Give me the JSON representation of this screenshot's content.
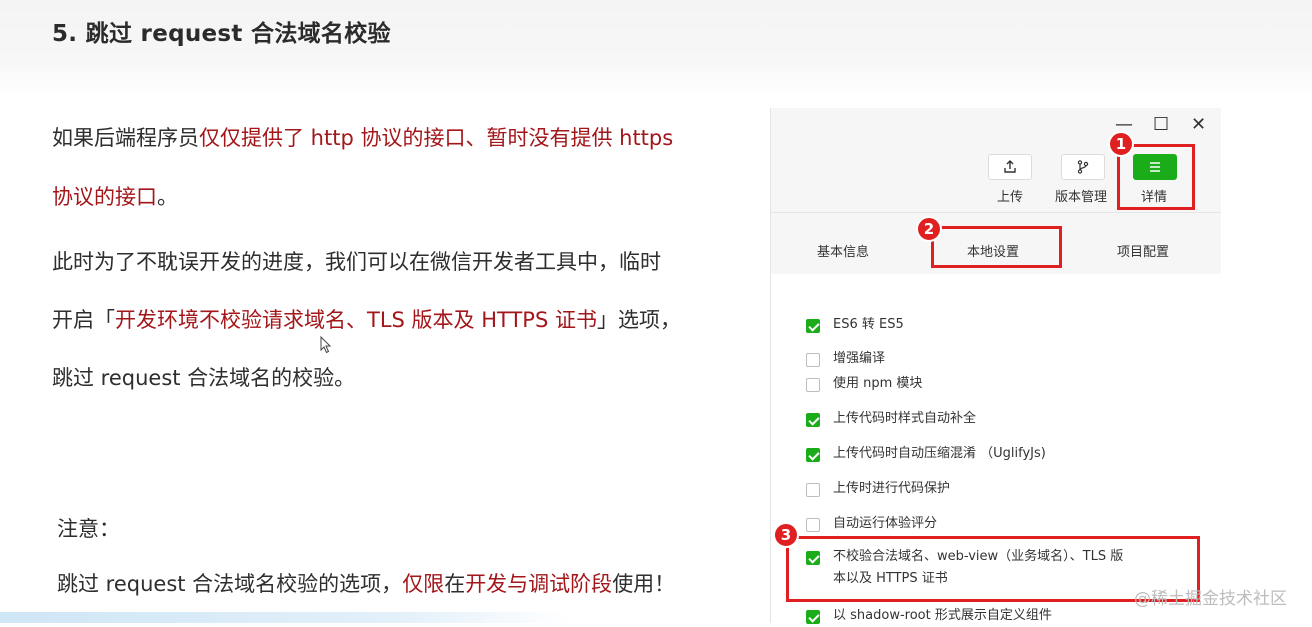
{
  "heading": "5. 跳过 request 合法域名校验",
  "para1": {
    "line1_prefix": "如果后端程序员",
    "line1_highlight": "仅仅提供了 http 协议的接口、暂时没有提供 https",
    "line2_highlight": "协议的接口",
    "line2_suffix": "。"
  },
  "para2": {
    "line1": "此时为了不耽误开发的进度，我们可以在微信开发者工具中，临时",
    "line2_prefix": "开启「",
    "line2_highlight": "开发环境不校验请求域名、TLS 版本及 HTTPS 证书",
    "line2_suffix": "」选项，",
    "line3": "跳过 request 合法域名的校验。"
  },
  "note": {
    "title": "注意：",
    "prefix": "跳过 request 合法域名校验的选项，",
    "hl1": "仅限",
    "mid": "在",
    "hl2": "开发与调试阶段",
    "suffix": "使用！"
  },
  "window": {
    "minimize": "—",
    "maximize": "☐",
    "close": "✕"
  },
  "toolbar": {
    "upload_label": "上传",
    "version_label": "版本管理",
    "details_label": "详情"
  },
  "tabs": {
    "basic": "基本信息",
    "local": "本地设置",
    "project": "项目配置"
  },
  "settings": [
    {
      "label": "ES6 转 ES5",
      "checked": true
    },
    {
      "label": "增强编译",
      "checked": false
    },
    {
      "label": "使用 npm 模块",
      "checked": false
    },
    {
      "label": "上传代码时样式自动补全",
      "checked": true
    },
    {
      "label": "上传代码时自动压缩混淆 （UglifyJs)",
      "checked": true
    },
    {
      "label": "上传时进行代码保护",
      "checked": false
    },
    {
      "label": "自动运行体验评分",
      "checked": false
    },
    {
      "label_line1": "不校验合法域名、web-view（业务域名）、TLS 版",
      "label_line2": "本以及 HTTPS 证书",
      "checked": true
    },
    {
      "label": "以 shadow-root 形式展示自定义组件",
      "checked": true
    }
  ],
  "badges": [
    "1",
    "2",
    "3"
  ],
  "watermark": "@稀土掘金技术社区",
  "colors": {
    "highlight_text": "#a3161a",
    "annotation_red": "#e02020",
    "wechat_green": "#1aad19"
  }
}
